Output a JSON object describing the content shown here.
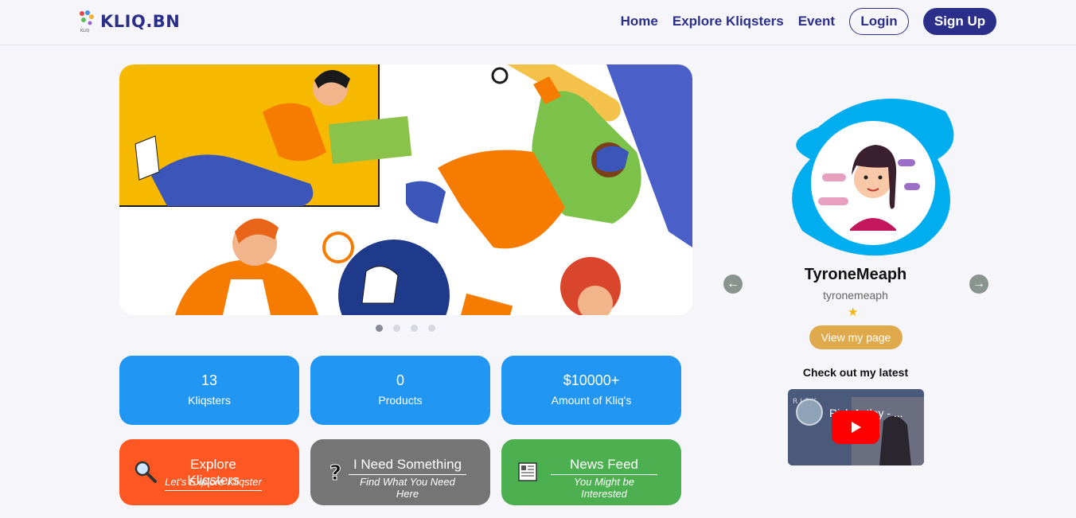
{
  "header": {
    "brand_name": "KLIQ.BN",
    "nav": [
      "Home",
      "Explore Kliqsters",
      "Event"
    ],
    "login_label": "Login",
    "signup_label": "Sign Up"
  },
  "carousel": {
    "slides": 4,
    "active_index": 0
  },
  "stats": [
    {
      "value": "13",
      "label": "Kliqsters"
    },
    {
      "value": "0",
      "label": "Products"
    },
    {
      "value": "$10000+",
      "label": "Amount of Kliq's"
    }
  ],
  "actions": [
    {
      "title": "Explore Kliqsters",
      "subtitle": "Let's Explore Kliqster",
      "icon": "magnifier-icon",
      "color": "#ff5722"
    },
    {
      "title": "I Need Something",
      "subtitle": "Find What You Need Here",
      "icon": "question-icon",
      "color": "#757575"
    },
    {
      "title": "News Feed",
      "subtitle": "You Might be Interested",
      "icon": "newspaper-icon",
      "color": "#4caf50"
    }
  ],
  "profile": {
    "name": "TyroneMeaph",
    "username": "tyronemeaph",
    "rating_stars": 1,
    "view_button": "View my page",
    "latest_heading": "Check out my latest",
    "video_title": "Rick Astley - ..."
  },
  "colors": {
    "brand": "#2c2f8a",
    "stat_blue": "#2196f3",
    "view_button": "#e0a94c",
    "avatar_ring": "#00aeef"
  }
}
